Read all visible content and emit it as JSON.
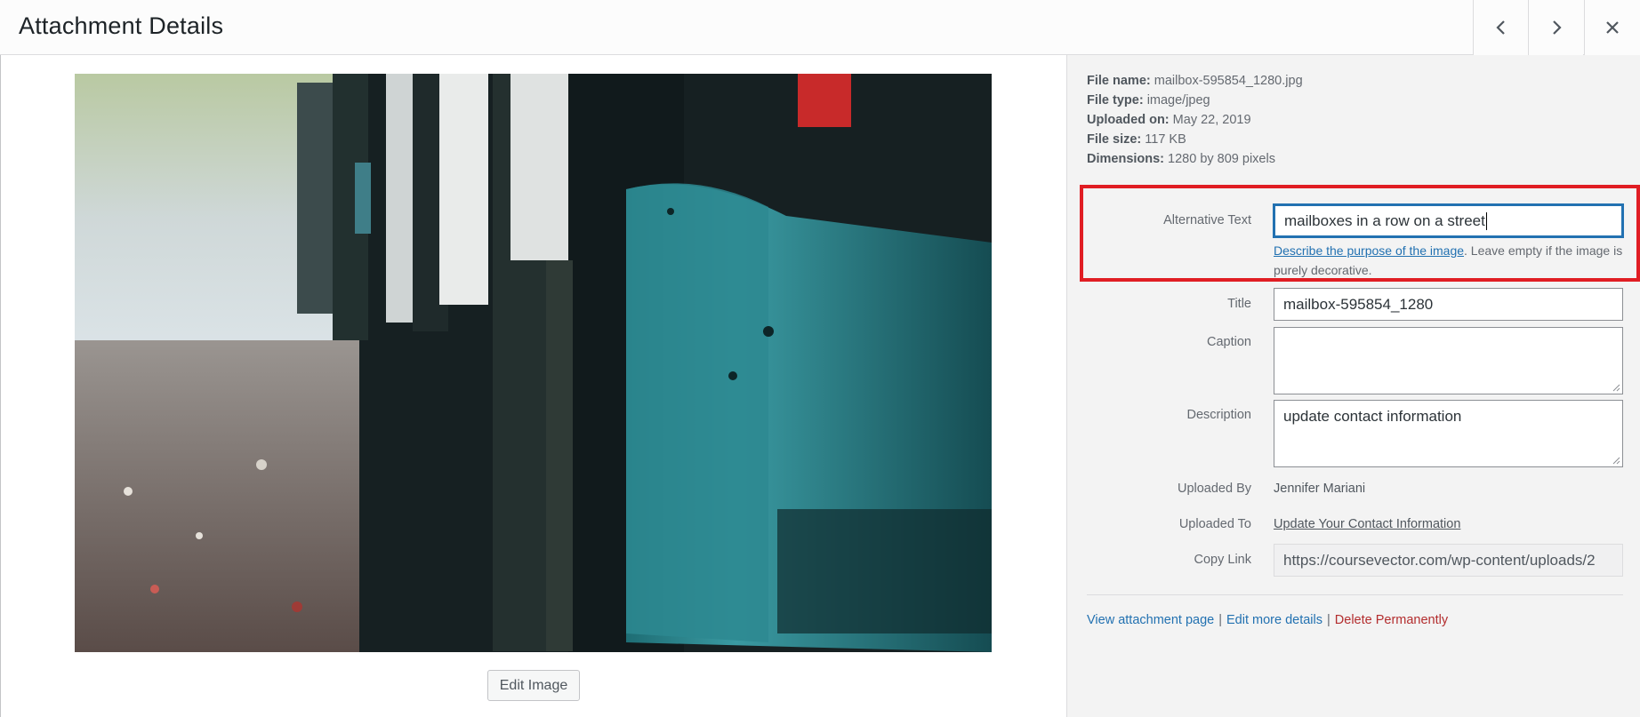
{
  "header": {
    "title": "Attachment Details",
    "prev_icon": "chevron-left-icon",
    "next_icon": "chevron-right-icon",
    "close_icon": "close-icon"
  },
  "preview": {
    "edit_label": "Edit Image"
  },
  "file_info": {
    "name_label": "File name:",
    "name_value": "mailbox-595854_1280.jpg",
    "type_label": "File type:",
    "type_value": "image/jpeg",
    "uploaded_label": "Uploaded on:",
    "uploaded_value": "May 22, 2019",
    "size_label": "File size:",
    "size_value": "117 KB",
    "dims_label": "Dimensions:",
    "dims_value": "1280 by 809 pixels"
  },
  "fields": {
    "alt": {
      "label": "Alternative Text",
      "value": "mailboxes in a row on a street",
      "help_link": "Describe the purpose of the image",
      "help_text": ". Leave empty if the image is purely decorative."
    },
    "title": {
      "label": "Title",
      "value": "mailbox-595854_1280"
    },
    "caption": {
      "label": "Caption",
      "value": ""
    },
    "description": {
      "label": "Description",
      "value": "update contact information"
    },
    "uploaded_by": {
      "label": "Uploaded By",
      "value": "Jennifer Mariani"
    },
    "uploaded_to": {
      "label": "Uploaded To",
      "value": "Update Your Contact Information"
    },
    "copy_link": {
      "label": "Copy Link",
      "value": "https://coursevector.com/wp-content/uploads/2"
    }
  },
  "actions": {
    "view": "View attachment page",
    "edit": "Edit more details",
    "delete": "Delete Permanently",
    "separator": "|"
  },
  "colors": {
    "highlight_border": "#e01d23",
    "link": "#2271b1",
    "danger": "#b32d2e",
    "sidebar_bg": "#f3f3f3"
  }
}
